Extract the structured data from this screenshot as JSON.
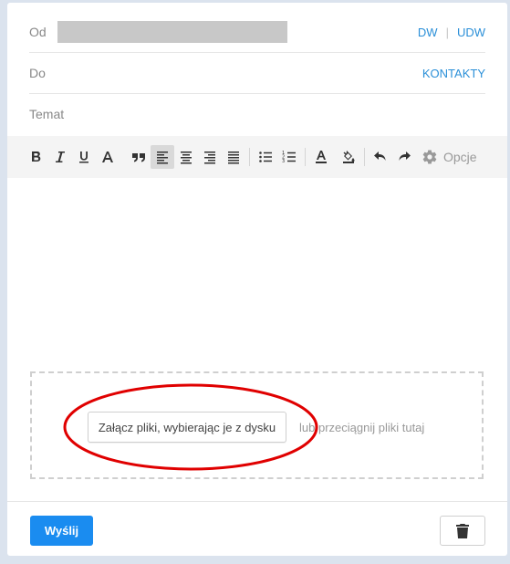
{
  "compose": {
    "from_label": "Od",
    "cc_label": "DW",
    "bcc_label": "UDW",
    "to_label": "Do",
    "contacts_label": "KONTAKTY",
    "subject_label": "Temat",
    "sender_value": ""
  },
  "toolbar": {
    "buttons": [
      {
        "icon": "bold-icon",
        "title": "B"
      },
      {
        "icon": "italic-icon",
        "title": "I"
      },
      {
        "icon": "underline-icon",
        "title": "U"
      },
      {
        "icon": "font-size-icon",
        "title": "A"
      },
      {
        "icon": "quote-icon"
      },
      {
        "icon": "align-left-icon",
        "active": true
      },
      {
        "icon": "align-center-icon"
      },
      {
        "icon": "align-right-icon"
      },
      {
        "icon": "align-justify-icon"
      },
      {
        "icon": "bullet-list-icon"
      },
      {
        "icon": "numbered-list-icon"
      },
      {
        "icon": "text-color-icon"
      },
      {
        "icon": "highlight-color-icon"
      },
      {
        "icon": "undo-icon"
      },
      {
        "icon": "redo-icon"
      },
      {
        "icon": "gear-icon"
      }
    ],
    "options_label": "Opcje"
  },
  "attachments": {
    "attach_button_label": "Załącz pliki, wybierając je z dysku",
    "drop_hint": "lub przeciągnij pliki tutaj"
  },
  "footer": {
    "send_label": "Wyślij",
    "trash_icon": "trash-icon"
  },
  "colors": {
    "accent": "#1a8cf0",
    "link": "#2a8fd8",
    "annotation": "#e00000",
    "page_background": "#dbe3ee"
  }
}
